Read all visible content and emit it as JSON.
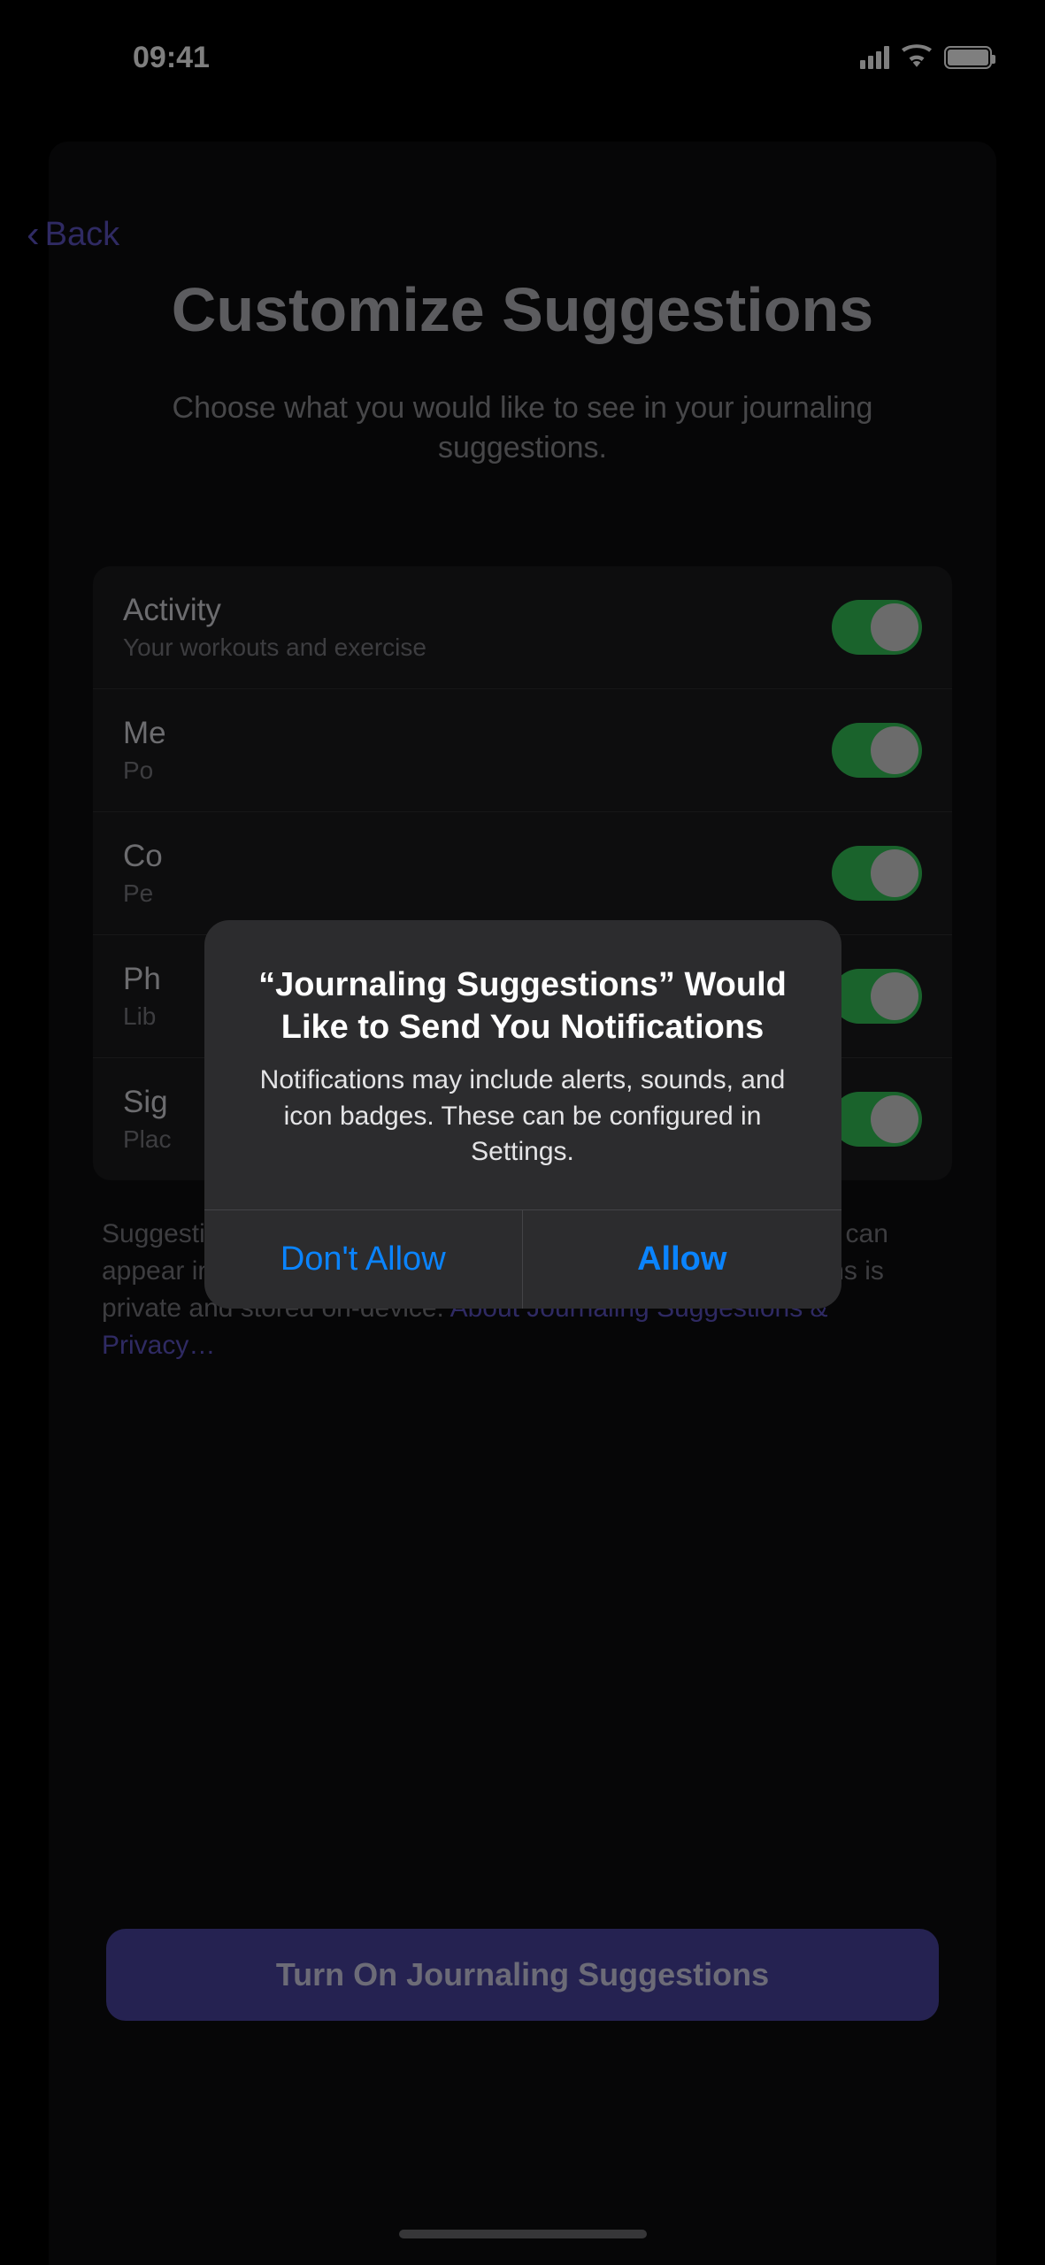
{
  "status": {
    "time": "09:41"
  },
  "nav": {
    "back_label": "Back"
  },
  "header": {
    "title": "Customize Suggestions",
    "subtitle": "Choose what you would like to see in your journaling suggestions."
  },
  "list": {
    "items": [
      {
        "title": "Activity",
        "subtitle": "Your workouts and exercise",
        "on": true
      },
      {
        "title": "Me",
        "subtitle": "Po",
        "on": true
      },
      {
        "title": "Co",
        "subtitle": "Pe",
        "on": true
      },
      {
        "title": "Ph",
        "subtitle": "Lib",
        "on": true
      },
      {
        "title": "Sig",
        "subtitle": "Plac",
        "on": true
      }
    ]
  },
  "footnote": {
    "text": "Suggestions use data from apps and services you turn on, and can appear in any app using suggestions. Data used for suggestions is private and stored on-device. ",
    "link_text": "About Journaling Suggestions & Privacy…"
  },
  "cta": {
    "label": "Turn On Journaling Suggestions"
  },
  "alert": {
    "title": "“Journaling Suggestions” Would Like to Send You Notifications",
    "message": "Notifications may include alerts, sounds, and icon badges. These can be configured in Settings.",
    "deny_label": "Don't Allow",
    "allow_label": "Allow"
  }
}
